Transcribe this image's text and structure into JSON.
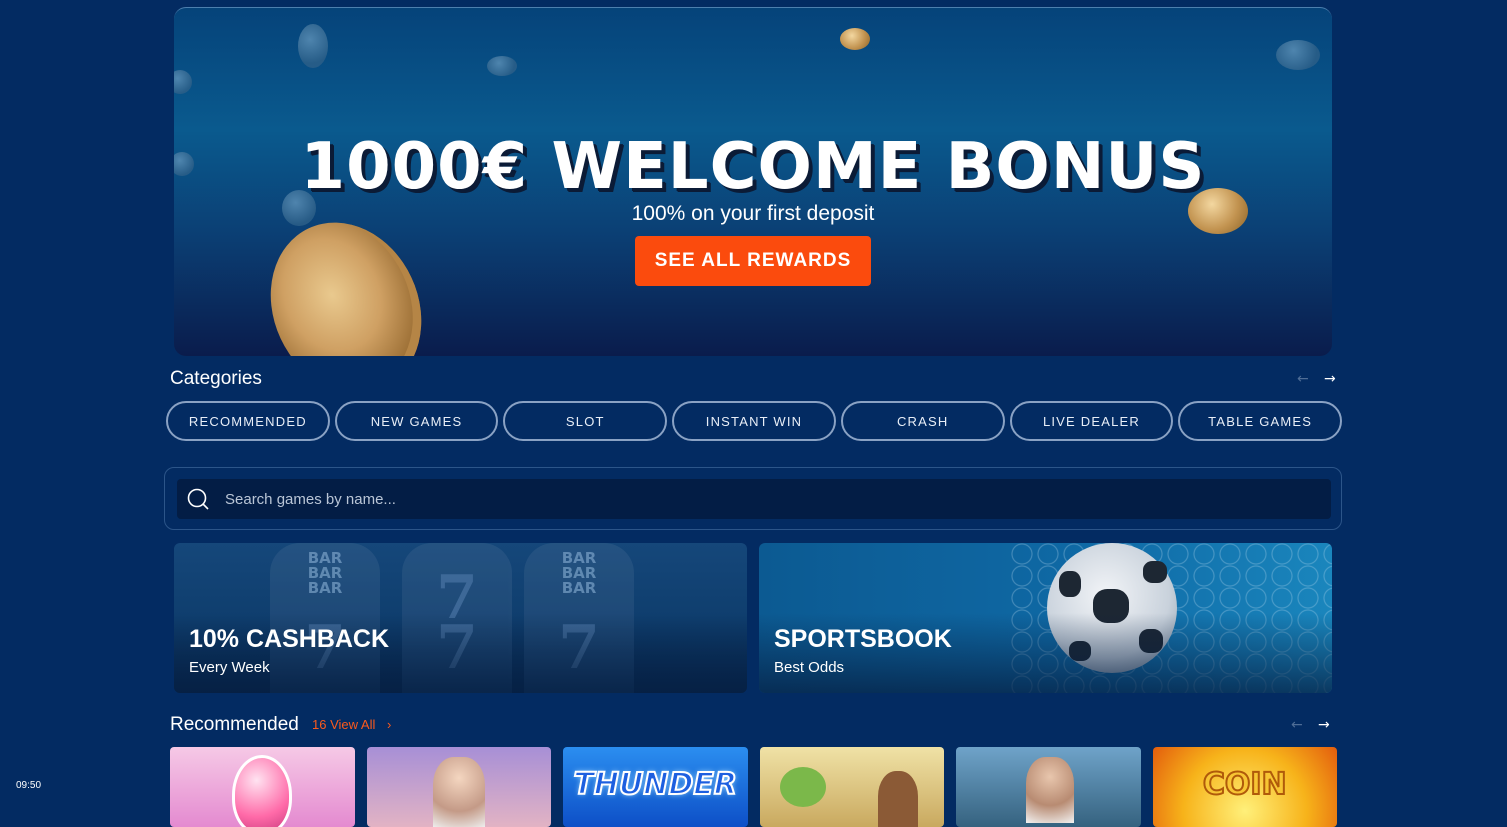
{
  "hero": {
    "title": "1000€ WELCOME BONUS",
    "subtitle": "100% on your first deposit",
    "cta_label": "SEE ALL REWARDS"
  },
  "categories": {
    "title": "Categories",
    "items": [
      "RECOMMENDED",
      "NEW GAMES",
      "SLOT",
      "INSTANT WIN",
      "CRASH",
      "LIVE DEALER",
      "TABLE GAMES"
    ]
  },
  "search": {
    "placeholder": "Search games by name..."
  },
  "promos": [
    {
      "title": "10% CASHBACK",
      "subtitle": "Every Week"
    },
    {
      "title": "SPORTSBOOK",
      "subtitle": "Best Odds"
    }
  ],
  "recommended": {
    "title": "Recommended",
    "view_all": "16 View All",
    "tiles": [
      {
        "label": ""
      },
      {
        "label": ""
      },
      {
        "label": "THUNDER"
      },
      {
        "label": ""
      },
      {
        "label": ""
      },
      {
        "label": "COIN"
      }
    ]
  },
  "reel_labels": {
    "bar": "BAR",
    "seven": "7"
  },
  "status": {
    "time": "09:50"
  },
  "colors": {
    "background": "#032b62",
    "accent": "#fb4b0d",
    "view_all": "#fb5a1c"
  },
  "icons": {
    "search": "search-icon",
    "prev": "arrow-left-icon",
    "next": "arrow-right-icon",
    "chevron": "chevron-right-icon"
  }
}
